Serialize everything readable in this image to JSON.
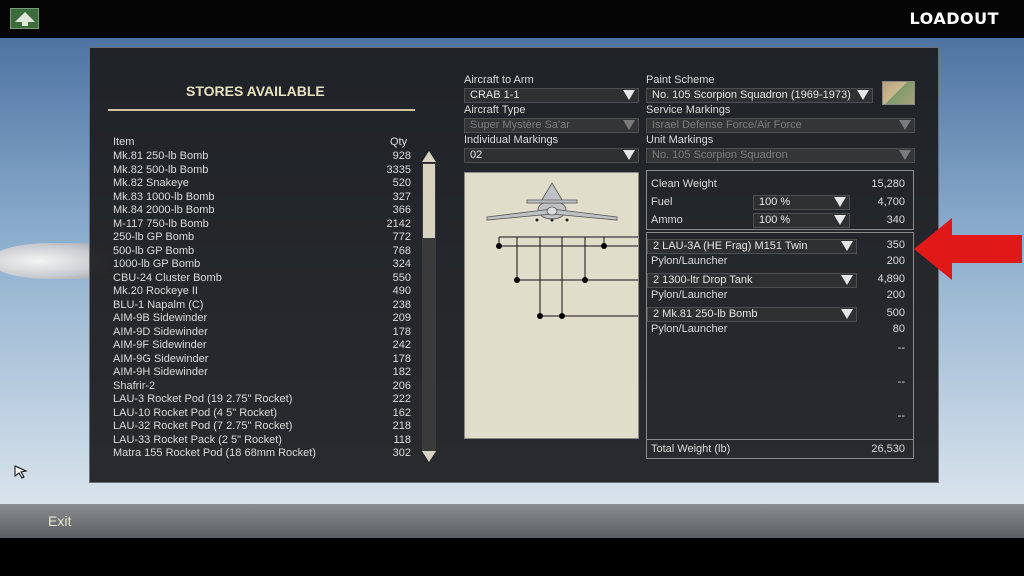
{
  "header": {
    "title": "LOADOUT"
  },
  "footer": {
    "exit_label": "Exit"
  },
  "stores": {
    "title": "STORES AVAILABLE",
    "col_item": "Item",
    "col_qty": "Qty",
    "items": [
      {
        "name": "Mk.81 250-lb Bomb",
        "qty": "928"
      },
      {
        "name": "Mk.82 500-lb Bomb",
        "qty": "3335"
      },
      {
        "name": "Mk.82 Snakeye",
        "qty": "520"
      },
      {
        "name": "Mk.83 1000-lb Bomb",
        "qty": "327"
      },
      {
        "name": "Mk.84 2000-lb Bomb",
        "qty": "366"
      },
      {
        "name": "M-117 750-lb Bomb",
        "qty": "2142"
      },
      {
        "name": "250-lb GP Bomb",
        "qty": "772"
      },
      {
        "name": "500-lb GP Bomb",
        "qty": "768"
      },
      {
        "name": "1000-lb GP Bomb",
        "qty": "324"
      },
      {
        "name": "CBU-24 Cluster Bomb",
        "qty": "550"
      },
      {
        "name": "Mk.20 Rockeye II",
        "qty": "490"
      },
      {
        "name": "BLU-1 Napalm (C)",
        "qty": "238"
      },
      {
        "name": "AIM-9B Sidewinder",
        "qty": "209"
      },
      {
        "name": "AIM-9D Sidewinder",
        "qty": "178"
      },
      {
        "name": "AIM-9F Sidewinder",
        "qty": "242"
      },
      {
        "name": "AIM-9G Sidewinder",
        "qty": "178"
      },
      {
        "name": "AIM-9H Sidewinder",
        "qty": "182"
      },
      {
        "name": "Shafrir-2",
        "qty": "206"
      },
      {
        "name": "LAU-3 Rocket Pod (19 2.75\" Rocket)",
        "qty": "222"
      },
      {
        "name": "LAU-10 Rocket Pod (4 5\" Rocket)",
        "qty": "162"
      },
      {
        "name": "LAU-32 Rocket Pod (7 2.75\" Rocket)",
        "qty": "218"
      },
      {
        "name": "LAU-33 Rocket Pack (2 5\" Rocket)",
        "qty": "118"
      },
      {
        "name": "Matra 155 Rocket Pod (18 68mm Rocket)",
        "qty": "302"
      }
    ]
  },
  "aircraft": {
    "arm_label": "Aircraft to Arm",
    "arm_value": "CRAB 1-1",
    "type_label": "Aircraft Type",
    "type_value": "Super Mystère Sa'ar",
    "markings_label": "Individual Markings",
    "markings_value": "02"
  },
  "paint": {
    "scheme_label": "Paint Scheme",
    "scheme_value": "No. 105 Scorpion Squadron (1969-1973)",
    "service_label": "Service Markings",
    "service_value": "Israel Defense Force/Air Force",
    "unit_label": "Unit Markings",
    "unit_value": "No. 105 Scorpion Squadron"
  },
  "weights": {
    "clean_label": "Clean Weight",
    "clean_value": "15,280",
    "fuel_label": "Fuel",
    "fuel_pct": "100 %",
    "fuel_value": "4,700",
    "ammo_label": "Ammo",
    "ammo_pct": "100 %",
    "ammo_value": "340",
    "total_label": "Total Weight (lb)",
    "total_value": "26,530"
  },
  "loadout": {
    "pylon_label": "Pylon/Launcher",
    "stations": [
      {
        "store": "2 LAU-3A (HE Frag) M151 Twin",
        "store_weight": "350",
        "pylon_weight": "200"
      },
      {
        "store": "2 1300-ltr Drop Tank",
        "store_weight": "4,890",
        "pylon_weight": "200"
      },
      {
        "store": "2 Mk.81 250-lb Bomb",
        "store_weight": "500",
        "pylon_weight": "80"
      }
    ],
    "empty": [
      "--",
      "--",
      "--"
    ]
  },
  "colors": {
    "accent": "#e9e2c0",
    "arrow": "#e01818",
    "panel": "#1c1c1e"
  },
  "icons": {
    "home": "up-arrow-icon",
    "cursor": "mouse-pointer-icon",
    "highlight": "left-arrow-icon"
  }
}
